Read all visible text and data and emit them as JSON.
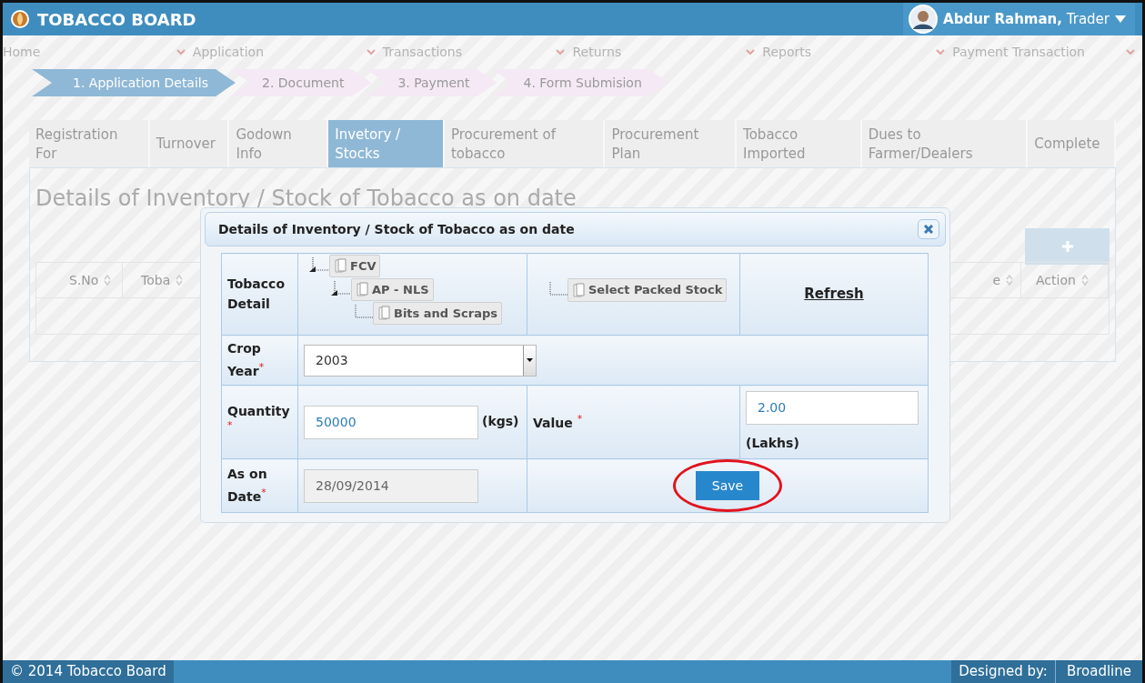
{
  "header": {
    "title": "TOBACCO BOARD",
    "user_name": "Abdur Rahman,",
    "user_role": "Trader"
  },
  "menu": [
    {
      "label": "Home"
    },
    {
      "label": "Application"
    },
    {
      "label": "Transactions"
    },
    {
      "label": "Returns"
    },
    {
      "label": "Reports"
    },
    {
      "label": "Payment Transaction"
    }
  ],
  "steps": [
    {
      "label": "1. Application Details",
      "selected": true
    },
    {
      "label": "2. Document",
      "selected": false
    },
    {
      "label": "3. Payment",
      "selected": false
    },
    {
      "label": "4. Form Submision",
      "selected": false
    }
  ],
  "tabs": [
    {
      "label": "Registration For",
      "selected": false
    },
    {
      "label": "Turnover",
      "selected": false
    },
    {
      "label": "Godown Info",
      "selected": false
    },
    {
      "label": "Invetory / Stocks",
      "selected": true
    },
    {
      "label": "Procurement of tobacco",
      "selected": false
    },
    {
      "label": "Procurement Plan",
      "selected": false
    },
    {
      "label": "Tobacco Imported",
      "selected": false
    },
    {
      "label": "Dues to Farmer/Dealers",
      "selected": false
    },
    {
      "label": "Complete",
      "selected": false
    }
  ],
  "panel": {
    "title": "Details of Inventory / Stock of Tobacco as on date",
    "columns": [
      "S.No",
      "Toba",
      "e",
      "Action"
    ]
  },
  "modal": {
    "title": "Details of Inventory / Stock of Tobacco as on date",
    "tobacco_detail_label": "Tobacco Detail",
    "tree": [
      {
        "label": "FCV",
        "expanded": true,
        "children": [
          {
            "label": "AP - NLS",
            "expanded": true,
            "children": [
              {
                "label": "Bits and Scraps"
              }
            ]
          }
        ]
      }
    ],
    "packed_stock": [
      {
        "label": "Select Packed Stock"
      }
    ],
    "refresh_link": "Refresh",
    "crop_year": {
      "label": "Crop Year",
      "mark": "*",
      "value": "2003"
    },
    "quantity": {
      "label": "Quantity",
      "mark": "*",
      "value": "50000",
      "unit": "(kgs)"
    },
    "value": {
      "label": "Value",
      "mark": "*",
      "value": "2.00",
      "unit": "(Lakhs)"
    },
    "as_on_date": {
      "label": "As on Date",
      "mark": "*",
      "value": "28/09/2014",
      "disabled": true
    },
    "save_button": {
      "label": "Save",
      "highlighted": true
    }
  },
  "footer": {
    "copyright": "© 2014 Tobacco Board",
    "designed_by_label": "Designed by:",
    "designer": "Broadline"
  }
}
